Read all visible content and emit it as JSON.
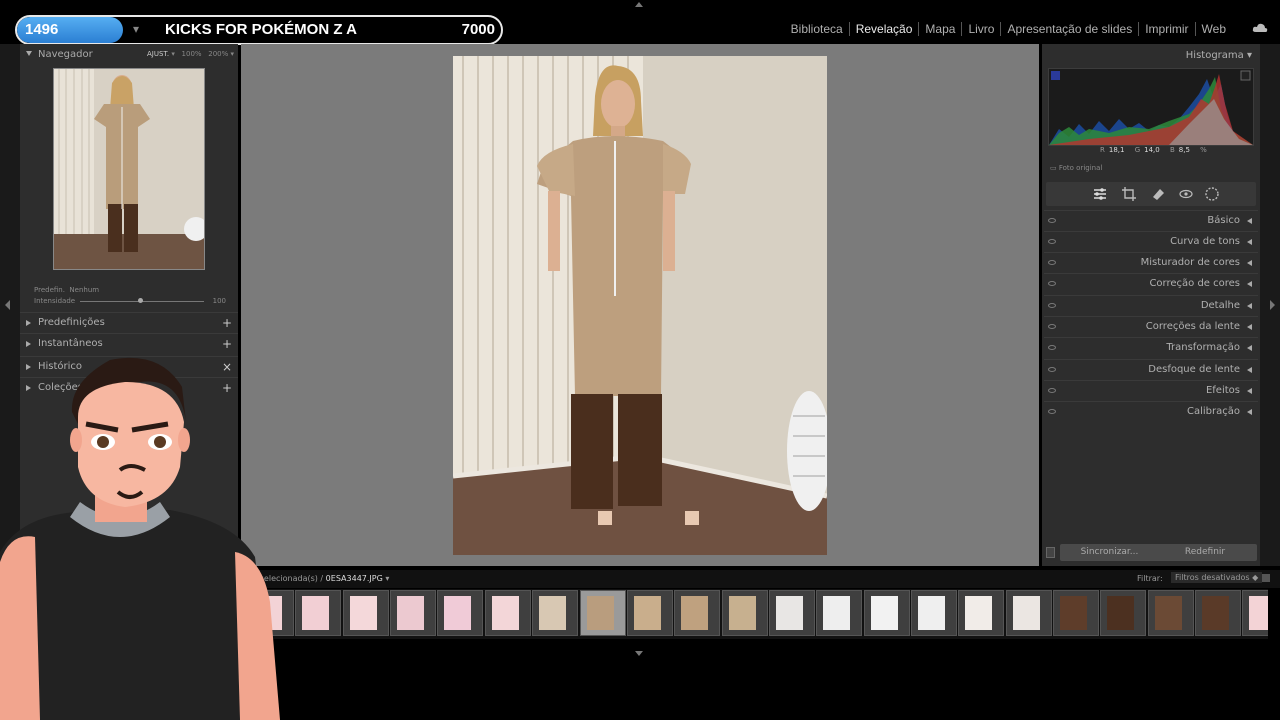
{
  "overlay": {
    "count": "1496",
    "title": "KICKS FOR POKÉMON Z A",
    "number": "7000"
  },
  "modules": [
    "Biblioteca",
    "Revelação",
    "Mapa",
    "Livro",
    "Apresentação de slides",
    "Imprimir",
    "Web"
  ],
  "active_module": "Revelação",
  "left": {
    "navigator_title": "Navegador",
    "nav_zoom": {
      "fit": "AJUST.",
      "z1": "100%",
      "z2": "200%"
    },
    "preset_label": "Predefin.",
    "preset_value": "Nenhum",
    "intensity_label": "Intensidade",
    "intensity_value": "100",
    "panels": [
      {
        "label": "Predefinições",
        "action": "+"
      },
      {
        "label": "Instantâneos",
        "action": "+"
      },
      {
        "label": "Histórico",
        "action": "×"
      },
      {
        "label": "Coleções",
        "action": "+"
      }
    ]
  },
  "right": {
    "histogram_title": "Histograma",
    "rgb": {
      "r_label": "R",
      "r": "18,1",
      "g_label": "G",
      "g": "14,0",
      "b_label": "B",
      "b": "8,5",
      "unit": "%"
    },
    "original_photo": "Foto original",
    "sections": [
      "Básico",
      "Curva de tons",
      "Misturador de cores",
      "Correção de cores",
      "Detalhe",
      "Correções da lente",
      "Transformação",
      "Desfoque de lente",
      "Efeitos",
      "Calibração"
    ],
    "sync_button": "Sincronizar...",
    "reset_button": "Redefinir"
  },
  "filmstrip": {
    "source": "s / 177 selecionada(s) /",
    "file": "0ESA3447.JPG",
    "filter_label": "Filtrar:",
    "filter_value": "Filtros desativados"
  }
}
